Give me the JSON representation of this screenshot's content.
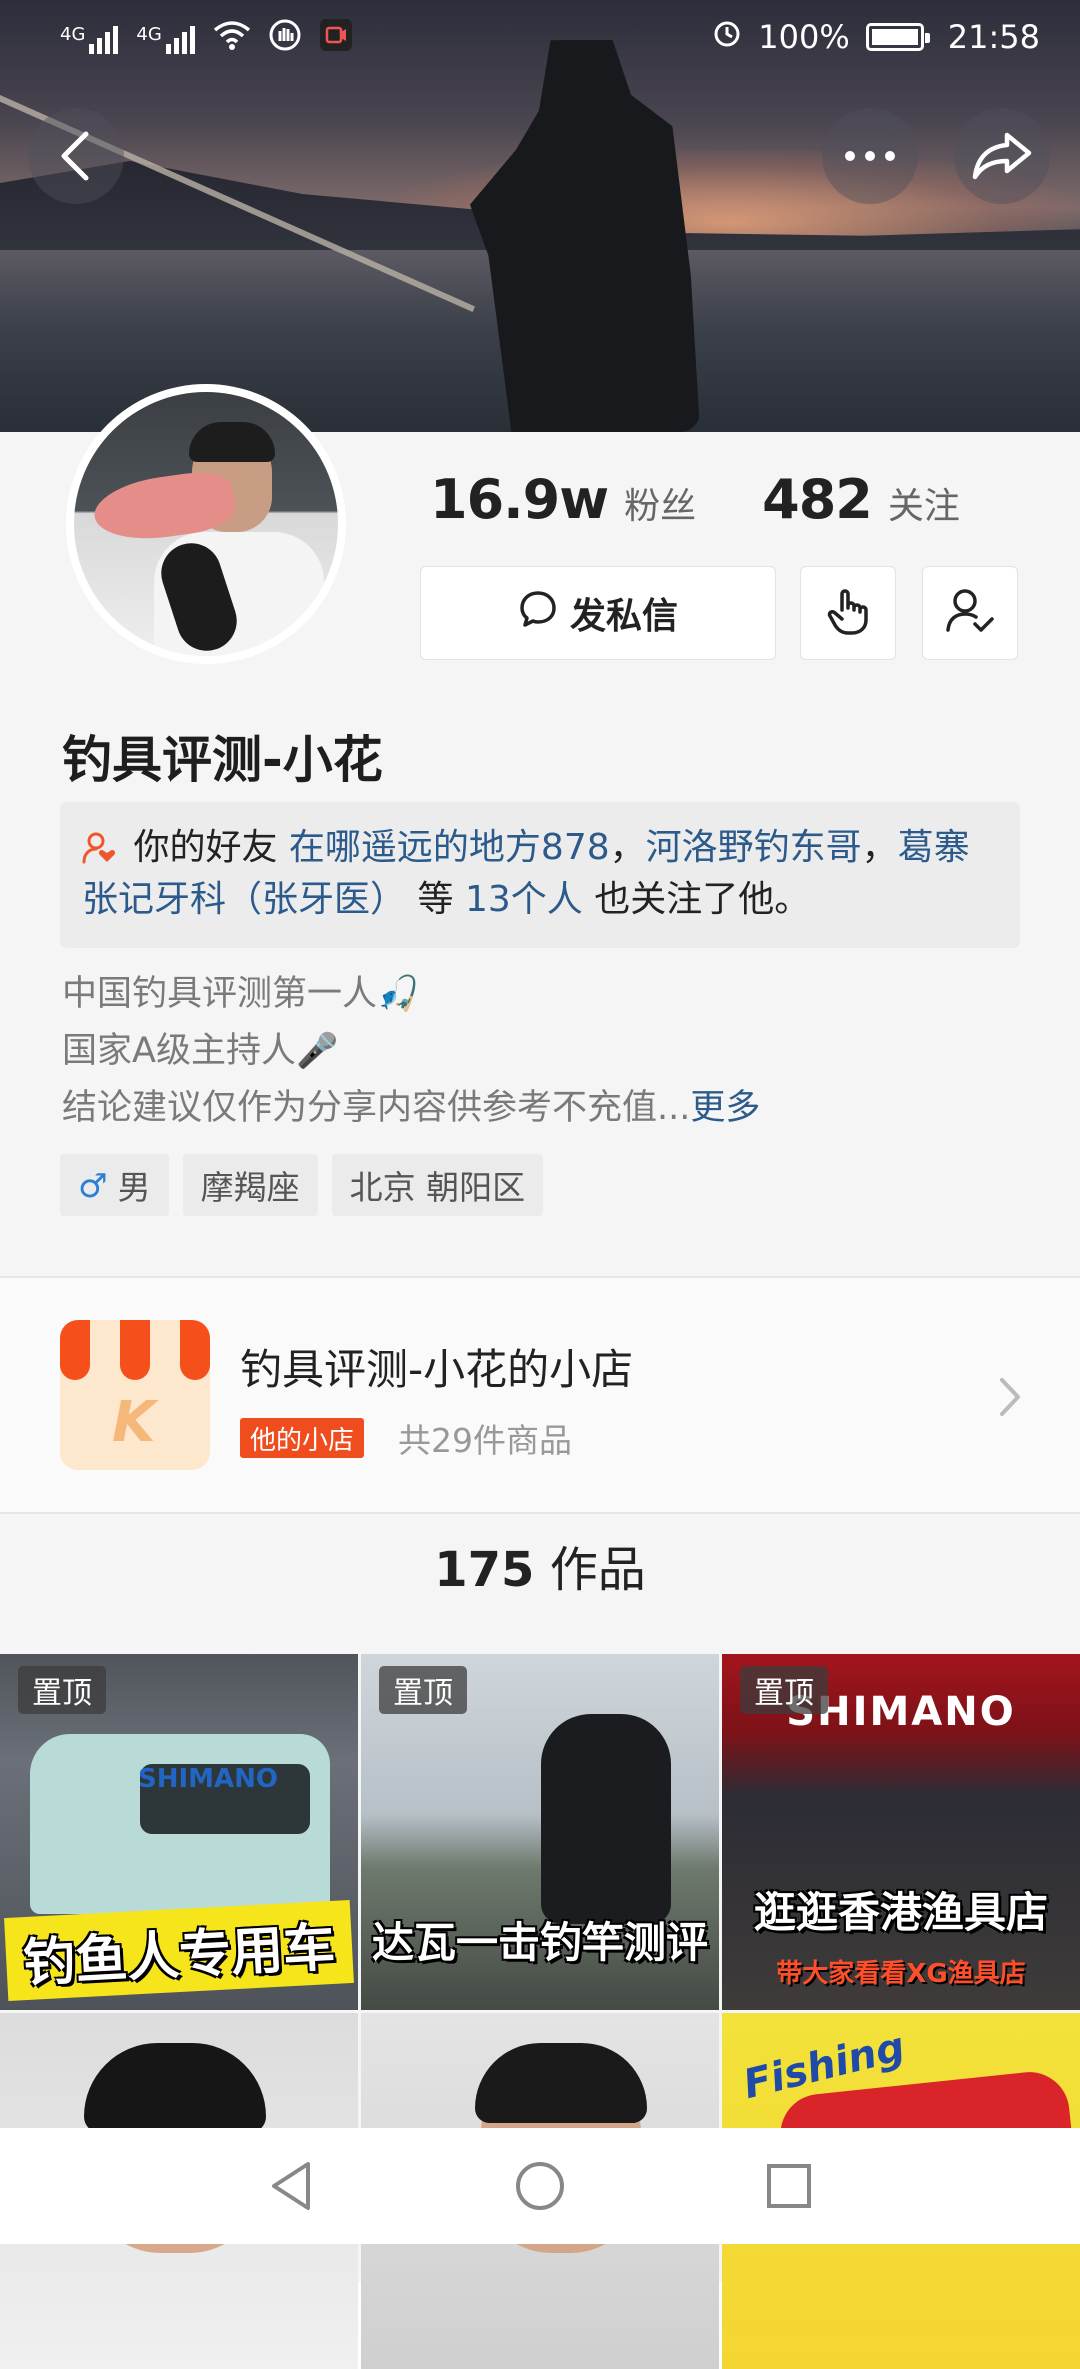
{
  "status_bar": {
    "network_1": "4G",
    "network_2": "4G",
    "battery": "100%",
    "time": "21:58"
  },
  "header": {
    "back_icon": "back-arrow-icon",
    "more_icon": "more-dots-icon",
    "share_icon": "share-icon"
  },
  "profile": {
    "followers_count": "16.9w",
    "followers_label": "粉丝",
    "following_count": "482",
    "following_label": "关注",
    "message_button": "发私信",
    "name": "钓具评测-小花",
    "friends": {
      "prefix": "你的好友",
      "friend_1": "在哪遥远的地方878",
      "sep_1": "，",
      "friend_2": "河洛野钓东哥",
      "sep_2": "，",
      "friend_3": "葛寨张记牙科（张牙医）",
      "mid": "等",
      "count": "13个人",
      "suffix": "也关注了他。"
    },
    "bio_line_1": "中国钓具评测第一人",
    "bio_line_2": "国家A级主持人",
    "bio_line_3": "结论建议仅作为分享内容供参考不充值...",
    "bio_more": "更多",
    "tags": {
      "gender_symbol": "♂",
      "gender": "男",
      "zodiac": "摩羯座",
      "location": "北京 朝阳区"
    }
  },
  "shop": {
    "title": "钓具评测-小花的小店",
    "badge": "他的小店",
    "count": "共29件商品",
    "icon_letter": "K"
  },
  "works": {
    "count": "175",
    "label": "作品"
  },
  "videos": [
    {
      "pinned": "置顶",
      "caption": "钓鱼人专用车",
      "brand": "SHIMANO"
    },
    {
      "pinned": "置顶",
      "caption": "达瓦一击钓竿测评"
    },
    {
      "pinned": "置顶",
      "caption": "逛逛香港渔具店",
      "subcaption": "带大家看看XG渔具店",
      "sign": "SHIMANO"
    },
    {},
    {},
    {
      "brand": "Fishing"
    }
  ],
  "colors": {
    "link": "#2b5a8b",
    "badge": "#f04d1f",
    "shop_stripe": "#f5501b"
  }
}
